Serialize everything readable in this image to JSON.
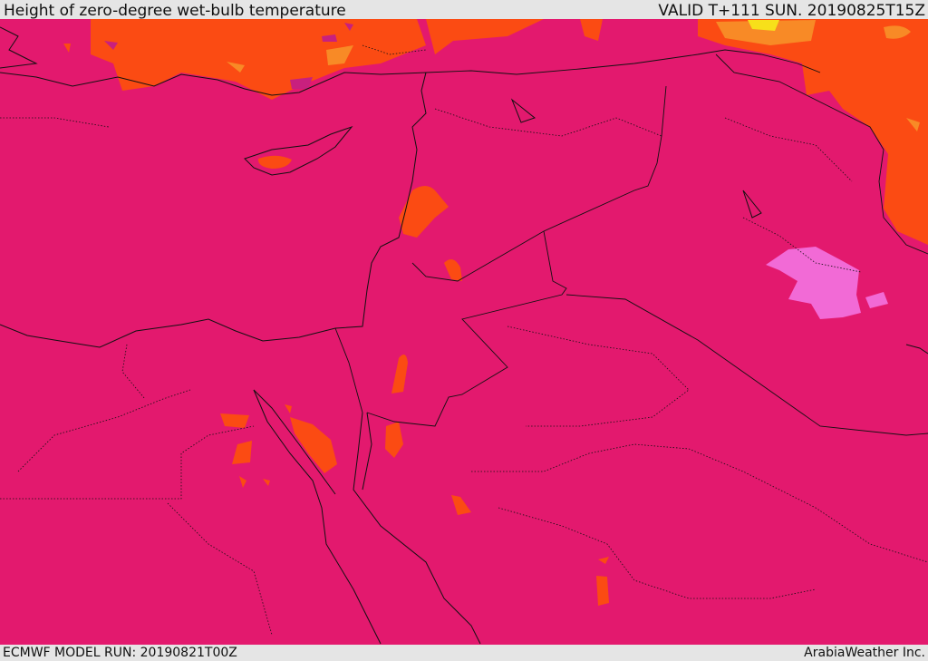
{
  "header": {
    "title": "Height of zero-degree wet-bulb temperature",
    "valid": "VALID T+111 SUN. 20190825T15Z"
  },
  "footer": {
    "model_run": "ECMWF MODEL RUN: 20190821T00Z",
    "credit": "ArabiaWeather Inc."
  },
  "colors": {
    "base": "#e3196e",
    "orange": "#fb4b13",
    "light_orange": "#f88a26",
    "yellow": "#f7e01a",
    "pink": "#f26ad6",
    "purple": "#c8207e"
  }
}
